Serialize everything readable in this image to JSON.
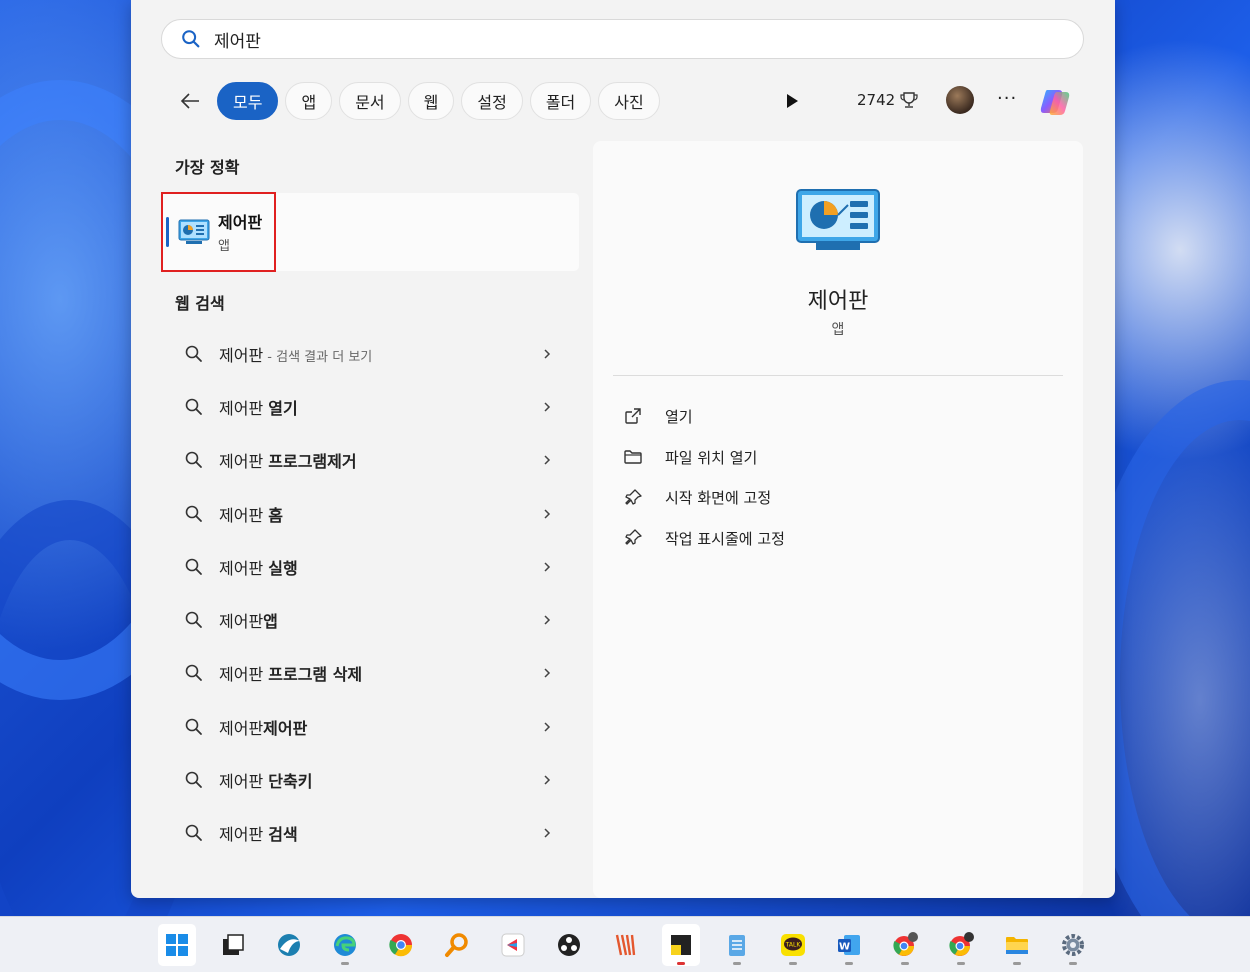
{
  "search": {
    "query": "제어판",
    "placeholder": ""
  },
  "filters": {
    "tabs": [
      "모두",
      "앱",
      "문서",
      "웹",
      "설정",
      "폴더",
      "사진"
    ],
    "active": "모두",
    "points": "2742"
  },
  "left": {
    "best_match_heading": "가장 정확",
    "best_match": {
      "title": "제어판",
      "subtitle": "앱"
    },
    "web_heading": "웹 검색",
    "web_items": [
      {
        "base": "제어판",
        "rest": "",
        "hint": " - 검색 결과 더 보기"
      },
      {
        "base": "제어판 ",
        "rest": "열기",
        "hint": ""
      },
      {
        "base": "제어판 ",
        "rest": "프로그램제거",
        "hint": ""
      },
      {
        "base": "제어판 ",
        "rest": "홈",
        "hint": ""
      },
      {
        "base": "제어판 ",
        "rest": "실행",
        "hint": ""
      },
      {
        "base": "제어판",
        "rest": "앱",
        "hint": ""
      },
      {
        "base": "제어판 ",
        "rest": "프로그램 삭제",
        "hint": ""
      },
      {
        "base": "제어판",
        "rest": "제어판",
        "hint": ""
      },
      {
        "base": "제어판 ",
        "rest": "단축키",
        "hint": ""
      },
      {
        "base": "제어판 ",
        "rest": "검색",
        "hint": ""
      }
    ]
  },
  "preview": {
    "title": "제어판",
    "subtitle": "앱",
    "actions": [
      {
        "label": "열기",
        "icon": "open-external-icon"
      },
      {
        "label": "파일 위치 열기",
        "icon": "folder-icon"
      },
      {
        "label": "시작 화면에 고정",
        "icon": "pin-icon"
      },
      {
        "label": "작업 표시줄에 고정",
        "icon": "pin-icon"
      }
    ]
  },
  "taskbar": {
    "apps": [
      "start",
      "task-view",
      "app-2",
      "edge",
      "chrome",
      "search-app",
      "app-7",
      "obs",
      "app-9",
      "sticky-notes",
      "notepad",
      "kakaotalk",
      "word",
      "chrome-profile-1",
      "chrome-profile-2",
      "file-explorer",
      "settings"
    ]
  },
  "colors": {
    "accent": "#1a63c5",
    "highlight": "#e02020",
    "panel": "#f3f3f3"
  }
}
